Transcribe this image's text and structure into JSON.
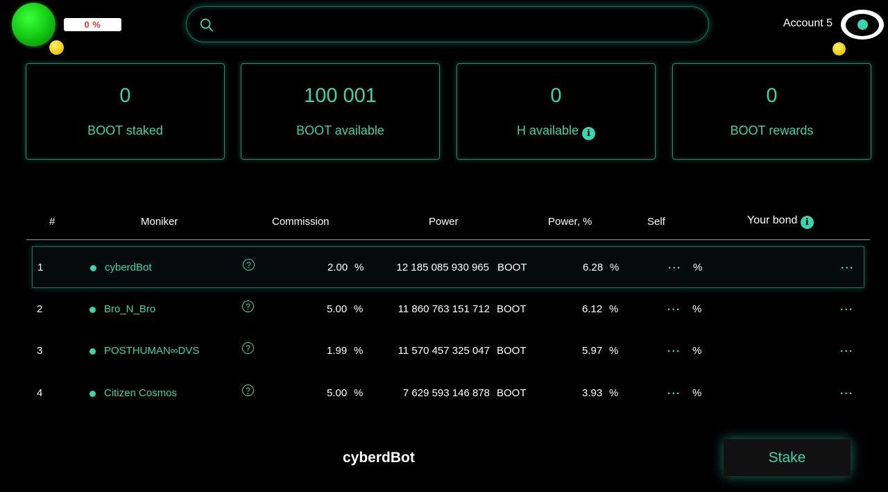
{
  "header": {
    "percent": "0 %",
    "search": {
      "value": "",
      "placeholder": ""
    },
    "account": "Account 5"
  },
  "stats": [
    {
      "value": "0",
      "label": "BOOT staked"
    },
    {
      "value": "100 001",
      "label": "BOOT available"
    },
    {
      "value": "0",
      "label": "H available"
    },
    {
      "value": "0",
      "label": "BOOT rewards"
    }
  ],
  "table": {
    "headers": {
      "num": "#",
      "moniker": "Moniker",
      "commission": "Commission",
      "power": "Power",
      "power_pct": "Power, %",
      "self": "Self",
      "your_bond": "Your bond"
    },
    "rows": [
      {
        "num": "1",
        "moniker": "cyberdBot",
        "commission": "2.00",
        "power": "12 185 085 930 965",
        "power_pct": "6.28",
        "self": "...",
        "bond": "..."
      },
      {
        "num": "2",
        "moniker": "Bro_N_Bro",
        "commission": "5.00",
        "power": "11 860 763 151 712",
        "power_pct": "6.12",
        "self": "...",
        "bond": "..."
      },
      {
        "num": "3",
        "moniker": "POSTHUMAN∞DVS",
        "commission": "1.99",
        "power": "11 570 457 325 047",
        "power_pct": "5.97",
        "self": "...",
        "bond": "..."
      },
      {
        "num": "4",
        "moniker": "Citizen Cosmos",
        "commission": "5.00",
        "power": "7 629 593 146 878",
        "power_pct": "3.93",
        "self": "...",
        "bond": "..."
      }
    ],
    "unit_pct": "%",
    "unit_token": "BOOT",
    "help_glyph": "?",
    "info_glyph": "i"
  },
  "footer": {
    "selected_name": "cyberdBot",
    "stake_label": "Stake"
  },
  "colors": {
    "accent": "#36d6ae",
    "background": "#000000",
    "orb": "#17d017",
    "coin": "#f0c400",
    "percent_text": "#e53a3a"
  }
}
